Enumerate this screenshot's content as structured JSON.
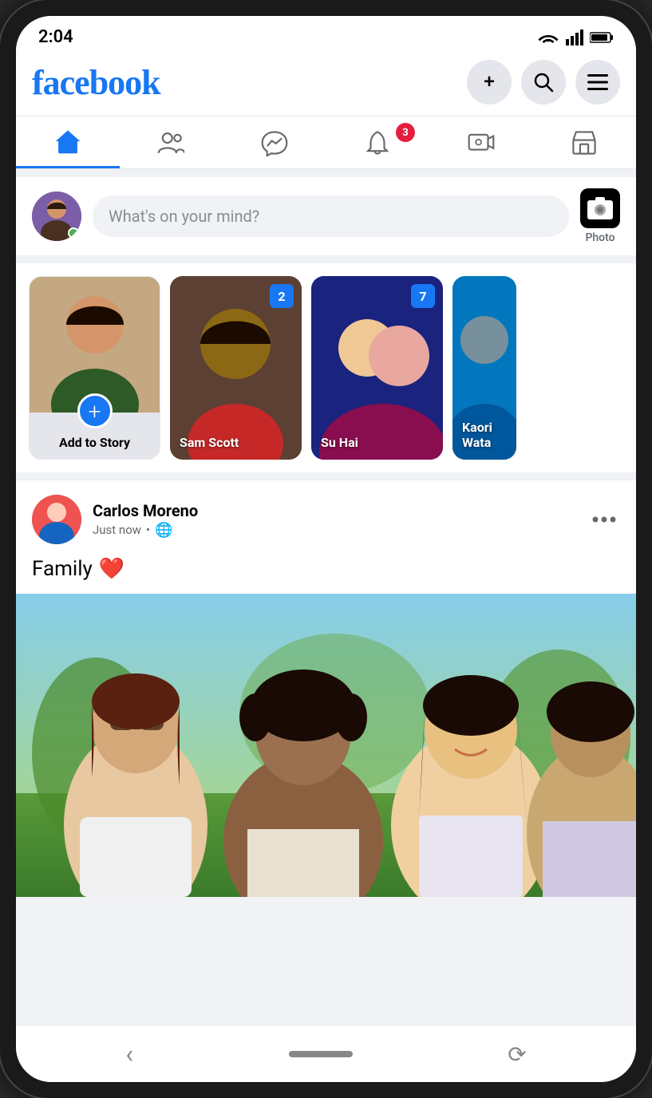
{
  "status_bar": {
    "time": "2:04",
    "wifi_icon": "wifi",
    "signal_icon": "signal",
    "battery_icon": "battery"
  },
  "header": {
    "logo": "facebook",
    "add_btn": "+",
    "search_btn": "🔍",
    "menu_btn": "☰"
  },
  "nav_tabs": [
    {
      "id": "home",
      "label": "Home",
      "active": true
    },
    {
      "id": "friends",
      "label": "Friends",
      "active": false
    },
    {
      "id": "messenger",
      "label": "Messenger",
      "active": false
    },
    {
      "id": "notifications",
      "label": "Notifications",
      "active": false,
      "badge": "3"
    },
    {
      "id": "watch",
      "label": "Watch",
      "active": false
    },
    {
      "id": "store",
      "label": "Store",
      "active": false
    }
  ],
  "composer": {
    "placeholder": "What's on your mind?",
    "photo_label": "Photo"
  },
  "stories": [
    {
      "id": "add",
      "label": "Add to Story",
      "type": "add"
    },
    {
      "id": "sam",
      "name": "Sam Scott",
      "count": "2",
      "type": "user"
    },
    {
      "id": "suhai",
      "name": "Su Hai",
      "count": "7",
      "type": "user"
    },
    {
      "id": "kaori",
      "name": "Kaori Wata",
      "type": "partial"
    }
  ],
  "post": {
    "user_name": "Carlos Moreno",
    "meta_time": "Just now",
    "meta_privacy": "🌐",
    "text": "Family",
    "emoji": "❤️"
  },
  "bottom_nav": {
    "back_btn": "‹",
    "rotate_btn": "⟳"
  }
}
